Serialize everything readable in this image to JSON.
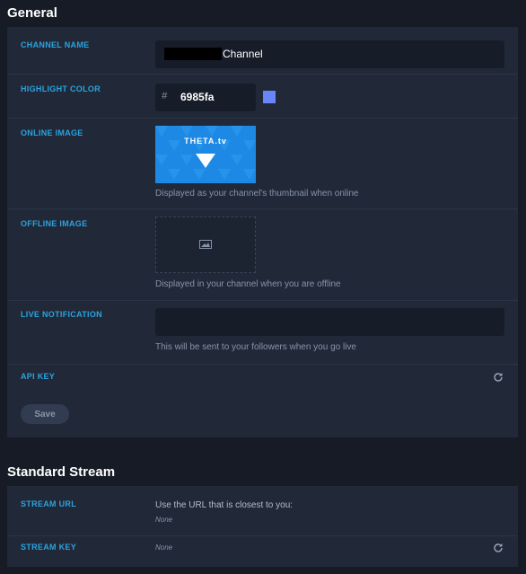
{
  "general": {
    "title": "General",
    "channel_name": {
      "label": "CHANNEL NAME",
      "value": "Channel"
    },
    "highlight_color": {
      "label": "HIGHLIGHT COLOR",
      "prefix": "#",
      "value": "6985fa",
      "swatch": "#6985fa"
    },
    "online_image": {
      "label": "ONLINE IMAGE",
      "logo_text": "THETA.tv",
      "help": "Displayed as your channel's thumbnail when online"
    },
    "offline_image": {
      "label": "OFFLINE IMAGE",
      "help": "Displayed in your channel when you are offline"
    },
    "live_notification": {
      "label": "LIVE NOTIFICATION",
      "value": "",
      "help": "This will be sent to your followers when you go live"
    },
    "api_key": {
      "label": "API KEY",
      "icon": "refresh-icon"
    },
    "save_label": "Save"
  },
  "standard_stream": {
    "title": "Standard Stream",
    "stream_url": {
      "label": "STREAM URL",
      "help": "Use the URL that is closest to you:",
      "value": "None"
    },
    "stream_key": {
      "label": "STREAM KEY",
      "value": "None",
      "icon": "refresh-icon"
    }
  },
  "colors": {
    "background": "#161b26",
    "panel": "#212939",
    "label": "#2aa3e0",
    "input": "#161c28",
    "thumbnail": "#1e88e5"
  }
}
